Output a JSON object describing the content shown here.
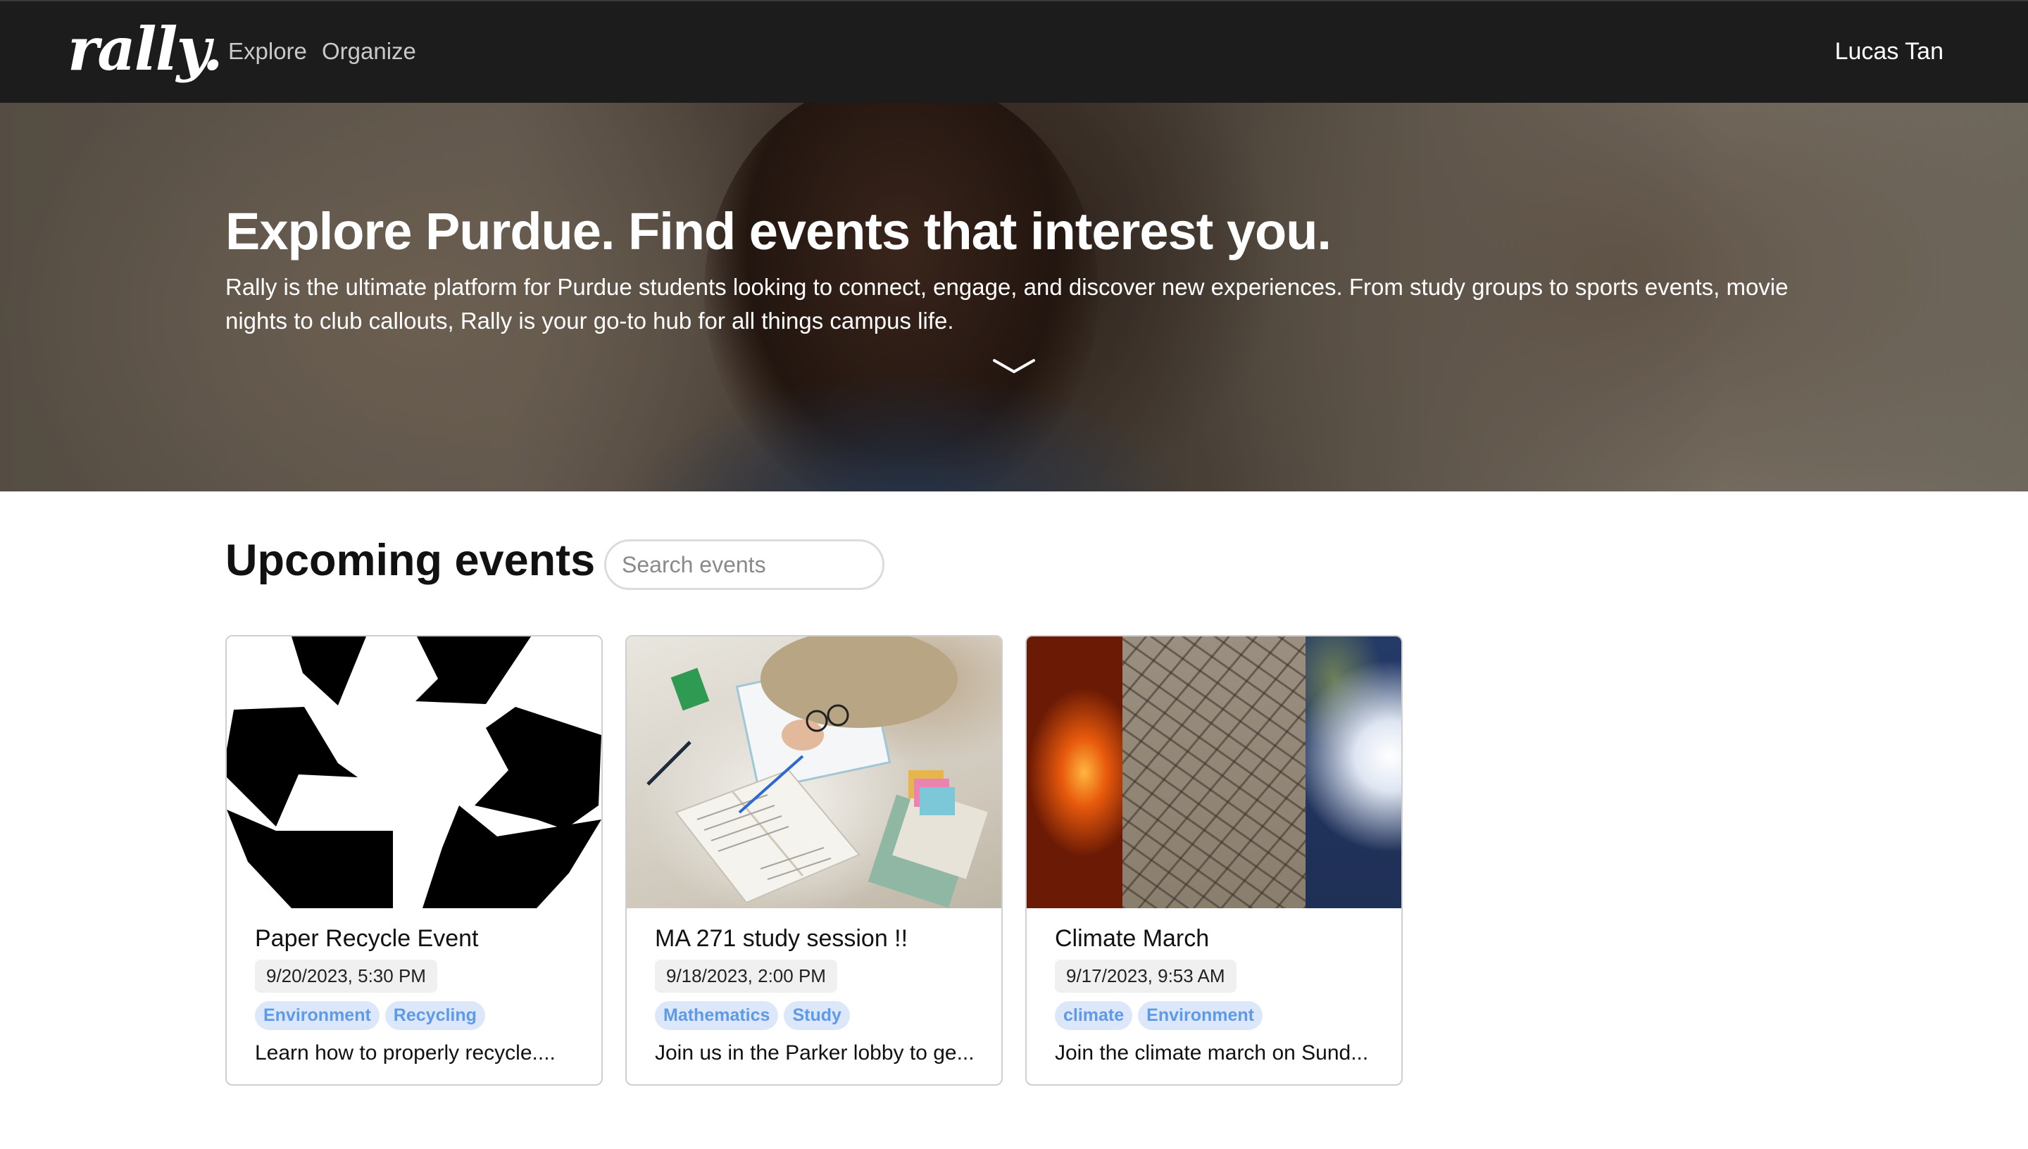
{
  "nav": {
    "logo": "rally.",
    "links": [
      "Explore",
      "Organize"
    ],
    "user": "Lucas Tan"
  },
  "hero": {
    "title": "Explore Purdue. Find events that interest you.",
    "description": "Rally is the ultimate platform for Purdue students looking to connect, engage, and discover new experiences. From study groups to sports events, movie nights to club callouts, Rally is your go-to hub for all things campus life.",
    "scroll_icon": "chevron-down-icon"
  },
  "events": {
    "title": "Upcoming events",
    "search_placeholder": "Search events",
    "cards": [
      {
        "title": "Paper Recycle Event",
        "date": "9/20/2023, 5:30 PM",
        "tags": [
          "Environment",
          "Recycling"
        ],
        "description": "Learn how to properly recycle...."
      },
      {
        "title": "MA 271 study session !!",
        "date": "9/18/2023, 2:00 PM",
        "tags": [
          "Mathematics",
          "Study"
        ],
        "description": "Join us in the Parker lobby to ge..."
      },
      {
        "title": "Climate March",
        "date": "9/17/2023, 9:53 AM",
        "tags": [
          "climate",
          "Environment"
        ],
        "description": "Join the climate march on Sund..."
      }
    ]
  },
  "colors": {
    "nav_bg": "#1c1c1c",
    "tag_bg": "#dce8fa",
    "tag_text": "#5e9ae8"
  }
}
